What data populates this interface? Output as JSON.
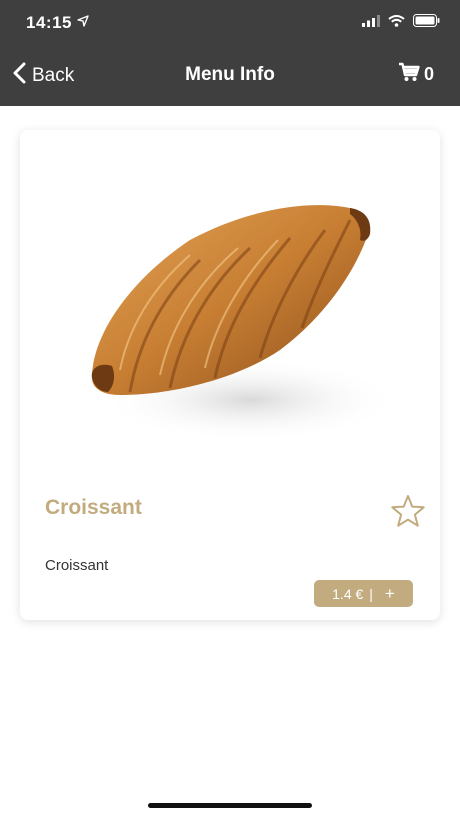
{
  "status_bar": {
    "time": "14:15",
    "icons": [
      "location-arrow-icon",
      "signal-icon",
      "wifi-icon",
      "battery-icon"
    ]
  },
  "nav": {
    "back_label": "Back",
    "title": "Menu Info",
    "cart_count": "0",
    "back_icon": "chevron-left-icon",
    "cart_icon": "cart-icon"
  },
  "product": {
    "name": "Croissant",
    "description": "Croissant",
    "price": "1.4 €",
    "separator": "|",
    "add_symbol": "+",
    "favorite_icon": "star-outline-icon",
    "image": "croissant-photo"
  },
  "colors": {
    "header_bg": "#3f3f3f",
    "accent": "#c2ac7f",
    "text": "#333333"
  }
}
